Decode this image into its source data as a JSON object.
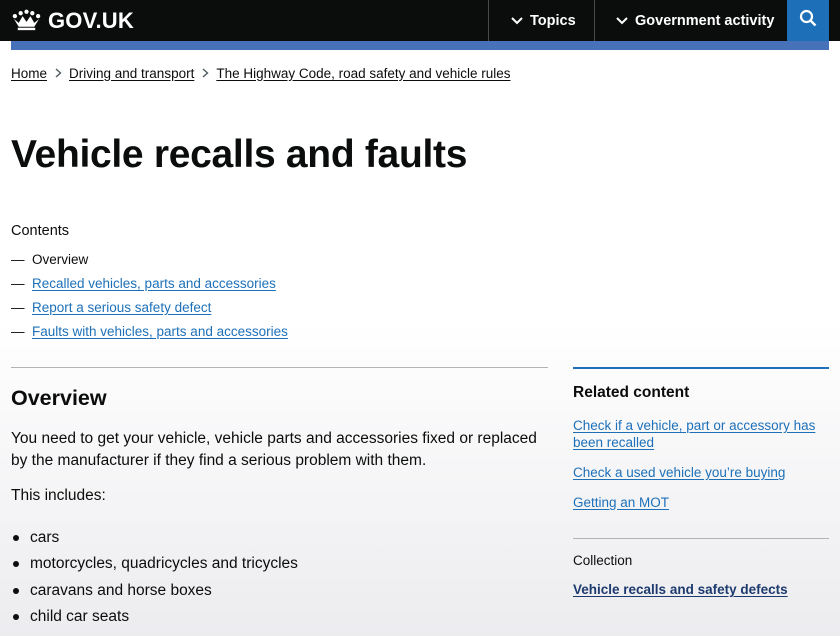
{
  "header": {
    "logo_text": "GOV.UK",
    "nav": [
      {
        "label": "Topics",
        "icon": "chevron-down-icon"
      },
      {
        "label": "Government activity",
        "icon": "chevron-down-icon"
      }
    ],
    "search_icon": "search-icon",
    "colors": {
      "header_bg": "#0b0c0c",
      "accent": "#1d70b8",
      "band": "#4771b8"
    }
  },
  "breadcrumbs": [
    {
      "label": "Home"
    },
    {
      "label": "Driving and transport"
    },
    {
      "label": "The Highway Code, road safety and vehicle rules"
    }
  ],
  "page_title": "Vehicle recalls and faults",
  "contents": {
    "heading": "Contents",
    "items": [
      {
        "label": "Overview",
        "current": true
      },
      {
        "label": "Recalled vehicles, parts and accessories",
        "current": false
      },
      {
        "label": "Report a serious safety defect",
        "current": false
      },
      {
        "label": "Faults with vehicles, parts and accessories",
        "current": false
      }
    ]
  },
  "overview": {
    "title": "Overview",
    "paragraph": "You need to get your vehicle, vehicle parts and accessories fixed or replaced by the manufacturer if they find a serious problem with them.",
    "includes": "This includes:",
    "bullets": [
      "cars",
      "motorcycles, quadricycles and tricycles",
      "caravans and horse boxes",
      "child car seats"
    ]
  },
  "related": {
    "title": "Related content",
    "links": [
      "Check if a vehicle, part or accessory has been recalled",
      "Check a used vehicle you’re buying",
      "Getting an MOT"
    ],
    "collection_label": "Collection",
    "collection_link": "Vehicle recalls and safety defects"
  }
}
